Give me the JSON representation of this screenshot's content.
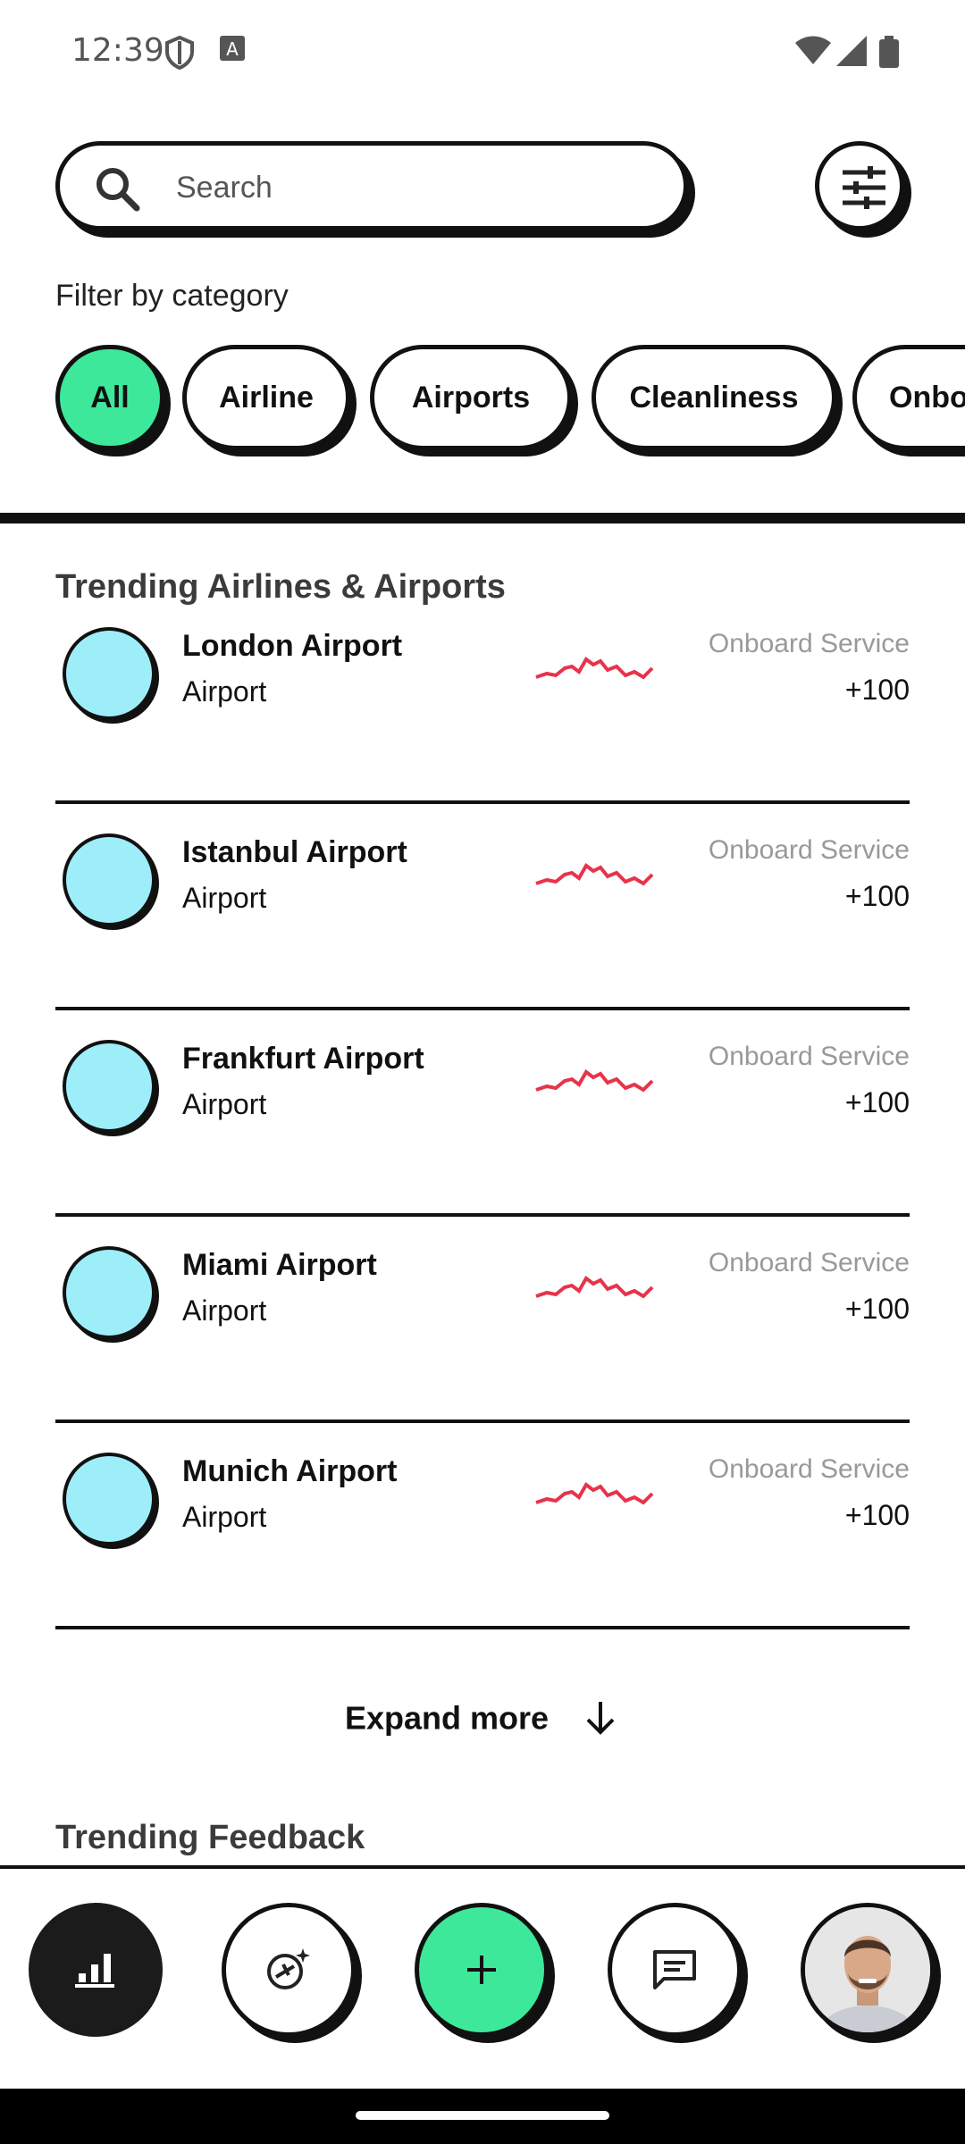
{
  "status_bar": {
    "time": "12:39"
  },
  "search": {
    "placeholder": "Search"
  },
  "filter_section": {
    "title": "Filter by category",
    "chips": [
      "All",
      "Airline",
      "Airports",
      "Cleanliness",
      "Onbo"
    ]
  },
  "trending": {
    "title": "Trending Airlines & Airports",
    "items": [
      {
        "name": "London Airport",
        "type": "Airport",
        "metric": "Onboard Service",
        "value": "+100"
      },
      {
        "name": "Istanbul Airport",
        "type": "Airport",
        "metric": "Onboard Service",
        "value": "+100"
      },
      {
        "name": "Frankfurt Airport",
        "type": "Airport",
        "metric": "Onboard Service",
        "value": "+100"
      },
      {
        "name": "Miami Airport",
        "type": "Airport",
        "metric": "Onboard Service",
        "value": "+100"
      },
      {
        "name": "Munich Airport",
        "type": "Airport",
        "metric": "Onboard Service",
        "value": "+100"
      }
    ],
    "expand_label": "Expand more"
  },
  "feedback": {
    "title": "Trending Feedback"
  },
  "colors": {
    "accent_green": "#3ee89b",
    "avatar_blue": "#9eeefa",
    "spark_red": "#e8334a"
  },
  "icons": [
    "search-icon",
    "sliders-icon",
    "chart-icon",
    "airplane-sparkle-icon",
    "plus-icon",
    "message-icon",
    "profile-avatar",
    "arrow-down-icon"
  ]
}
